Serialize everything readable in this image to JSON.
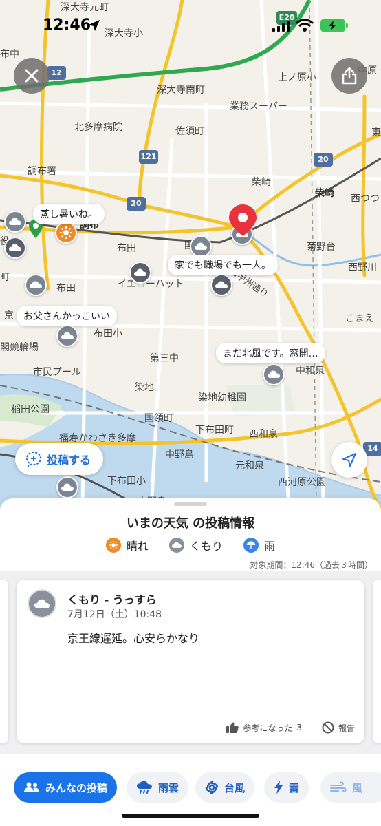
{
  "status_bar": {
    "time": "12:46"
  },
  "map": {
    "labels": [
      "深大寺元町",
      "深大寺小",
      "布中",
      "上ノ原小",
      "中原",
      "深大寺南町",
      "業務スーパー",
      "北多摩病院",
      "佐須町",
      "東",
      "調布署",
      "柴崎",
      "柴崎",
      "西つつじ",
      "調布",
      "布田",
      "国",
      "菊野台",
      "西野川",
      "役",
      "町",
      "布田",
      "イエローハット",
      "京",
      "こまえ",
      "布田小",
      "閣競輪場",
      "第三中",
      "市民プール",
      "中和泉",
      "染地",
      "染地幼稚園",
      "稲田公園",
      "国領町",
      "福寿かわさき多摩",
      "下布田町",
      "西和泉",
      "中野島",
      "元和泉",
      "西河原公園",
      "下布田小",
      "中野島"
    ],
    "route_badges": [
      "E20",
      "12",
      "121",
      "20",
      "20",
      "14"
    ],
    "bubbles": {
      "b1": "蒸し暑いね。",
      "b2": "家でも職場でも一人。",
      "b3": "お父さんかっこいい",
      "b4": "まだ北風です。窓開…"
    },
    "road_label": "旧甲州通り",
    "post_button_label": "投稿する"
  },
  "sheet": {
    "title": "いまの天気 の投稿情報",
    "legend": [
      {
        "label": "晴れ",
        "color": "#f08a24",
        "icon": "sun-icon"
      },
      {
        "label": "くもり",
        "color": "#8a919c",
        "icon": "cloud-icon"
      },
      {
        "label": "雨",
        "color": "#3a86e8",
        "icon": "umbrella-icon"
      }
    ],
    "period": "対象期間：12:46（過去３時間）",
    "card": {
      "title": "くもり - うっすら",
      "date": "7月12日（土）10:48",
      "body": "京王線遅延。心安らかなり",
      "helpful_label": "参考になった",
      "helpful_count": "3",
      "report_label": "報告"
    },
    "tabs": [
      "みんなの投稿",
      "雨雲",
      "台風",
      "雷",
      "風"
    ]
  },
  "colors": {
    "accent": "#1a73e8",
    "pin": "#e8323c",
    "sun": "#f08a24",
    "cloud": "#8a919c"
  }
}
